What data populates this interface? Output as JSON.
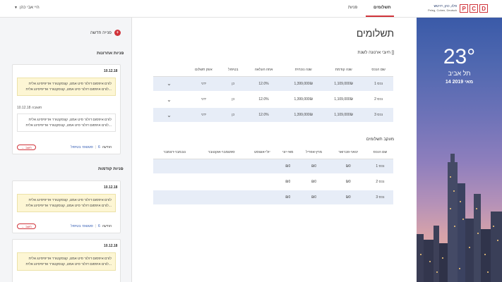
{
  "header": {
    "user_label": "היי אבי כהן",
    "tabs": [
      {
        "label": "תשלומים",
        "active": true
      },
      {
        "label": "פניות",
        "active": false
      }
    ],
    "logo": {
      "line1": "פלג, כהן, דויטש",
      "line2": "Peleg, Cohen, Deutsch",
      "letters": [
        "P",
        "C",
        "D"
      ]
    },
    "accent_color": "#d0333a"
  },
  "sidebar": {
    "new_request": "פנייה חדשה",
    "recent_title": "פניות אחרונות",
    "previous_title": "פניות קודמות",
    "recent_card": {
      "date": "10.12.18",
      "note": "לורם איפסום דולור סיט אמט, קונסקטורר אדיפיסינג אלית לורם איפסום דולור סיט אמט, קונסקטורר אדיפיסינג אלית...",
      "reply_meta_date": "10.12.18",
      "reply_meta_label": "תשובה",
      "reply_text": "לורם איפסום דולור סיט אמט, קונסקטורר אדיפיסינג אלית לורם איפסום דולור סיט אמט, קונסקטורר אדיפיסינג אלית...",
      "status_label": "הודעה",
      "status_number": "6",
      "status_value": "סטטוס: בטיפול",
      "reply_button": "← השב"
    },
    "previous_cards": [
      {
        "date": "10.12.18",
        "note": "לורם איפסום דולור סיט אמט, קונסקטורר אדיפיסינג אלית לורם איפסום דולור סיט אמט, קונסקטורר אדיפיסינג אלית...",
        "status_label": "הודעה",
        "status_number": "6",
        "status_value": "סטטוס: בטיפול",
        "reply_button": "← השב"
      },
      {
        "date": "10.12.18",
        "note": "לורם איפסום דולור סיט אמט, קונסקטורר אדיפיסינג אלית לורם איפסום דולור סיט אמט, קונסקטורר אדיפיסינג אלית..."
      }
    ]
  },
  "main": {
    "title": "תשלומים",
    "annual_title": "חיובי ארנונה לשנת []",
    "annual_table": {
      "headers": [
        "שם הנכס",
        "שנה קודמת",
        "שנה נוכחית",
        "אחוז העלאה",
        "בטיפול",
        "אופן תשלום"
      ],
      "rows": [
        [
          "נכס 1",
          "1,109,000₪",
          "1,399,000₪",
          "12.0%",
          "כן",
          "ידני"
        ],
        [
          "נכס 2",
          "1,109,000₪",
          "1,399,000₪",
          "12.0%",
          "כן",
          "ידני"
        ],
        [
          "נכס 3",
          "1,109,000₪",
          "1,399,000₪",
          "12.0%",
          "כן",
          "ידני"
        ]
      ]
    },
    "tracking_title": "מעקב תשלומים",
    "tracking_table": {
      "headers": [
        "שם הנכס",
        "ינואר-פברואר",
        "מרץ-אפריל",
        "מאי-יוני",
        "יולי-אוגוסט",
        "ספטמבר-אוקטובר",
        "נובמבר-דצמבר"
      ],
      "rows": [
        [
          "נכס 1",
          "₪0",
          "₪0",
          "₪0",
          "",
          "",
          ""
        ],
        [
          "נכס 2",
          "₪0",
          "₪0",
          "₪0",
          "",
          "",
          ""
        ],
        [
          "נכס 3",
          "₪0",
          "₪0",
          "₪0",
          "",
          "",
          ""
        ]
      ]
    }
  },
  "hero": {
    "temperature": "23°",
    "city": "תל אביב",
    "date": "14 מאי 2019"
  }
}
